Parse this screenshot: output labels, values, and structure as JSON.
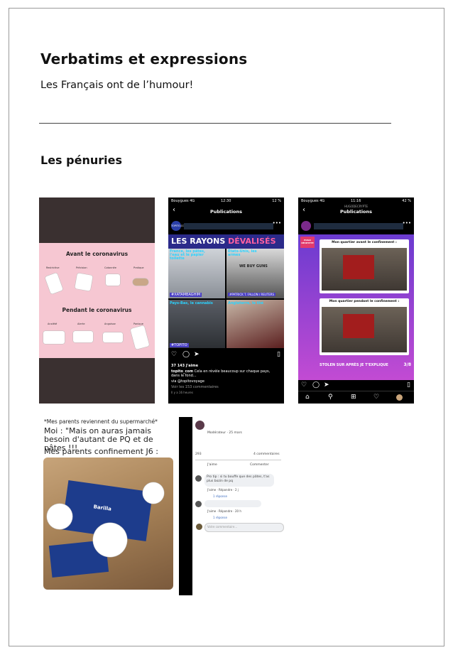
{
  "document": {
    "title": "Verbatims et expressions",
    "subtitle": "Les Français ont de l’humour!",
    "section": "Les pénuries"
  },
  "meme1": {
    "heading_before": "Avant le coronavirus",
    "heading_after": "Pendant le coronavirus",
    "labels_before": [
      "Restrictive",
      "Précision",
      "Cotonnée",
      "Pratique"
    ],
    "labels_after": [
      "Anxiété",
      "Alerte",
      "Angoisse",
      "Panique"
    ]
  },
  "phone1": {
    "carrier": "Bouygues 4G",
    "time": "12:30",
    "battery": "12 %",
    "nav_title": "Publications",
    "account": "TOPITO.COM",
    "banner_main": "LES RAYONS",
    "banner_accent": "DÉVALISÉS",
    "tiles": [
      {
        "caption": "France, les pâtes, l'eau et le papier toilette"
      },
      {
        "caption": "États-Unis, les armes"
      },
      {
        "caption": "Pays-Bas, le cannabis"
      },
      {
        "caption": "Angleterre, le thé"
      }
    ],
    "sign": "WE BUY GUNS",
    "credit1": "#XATAMBAGHIM",
    "credit2": "#PATRICK T. FALLON / REUTERS",
    "tag": "#TOPITO",
    "likes": "37 143 J'aime",
    "post_author": "topito_com",
    "post_text": "Cela en révèle beaucoup sur chaque pays, dans le fond...",
    "via": "via @topitovoyage",
    "comments": "Voir les 153 commentaires",
    "ago": "Il y a 16 heures"
  },
  "phone2": {
    "carrier": "Bouygues 4G",
    "time": "11:16",
    "battery": "42 %",
    "account": "HUGODECRYPTE",
    "nav_title": "Publications",
    "avatar_label": "HUGO DÉCRYPTE",
    "before_label": "Mon quartier avant le confinement :",
    "during_label": "Mon quartier pendant le confinement :",
    "footer": "STOLEN SUR APRÈS JE T'EXPLIQUE",
    "page": "3/8"
  },
  "meme4": {
    "line1": "*Mes parents reviennent du supermarché*",
    "line2": "Moi : \"Mais on auras jamais besoin d'autant de PQ et de pâtes !!!",
    "line3": "Mes parents confinement J6 :",
    "brand": "Barilla"
  },
  "facebook": {
    "role": "Modérateur · 25 mars",
    "reaction_count": "293",
    "comment_count": "4 commentaires",
    "like": "J'aime",
    "comment": "Commenter",
    "reply1": "Pro tip : si tu bouffe que des pâtes, t'as plus bozin de pq",
    "actions1": "J'aime · Répondre · 2 j",
    "replies1": "1 réponse",
    "actions2": "J'aime · Répondre · 20 h",
    "replies2": "1 réponse",
    "composer_placeholder": "Votre commentaire..."
  }
}
